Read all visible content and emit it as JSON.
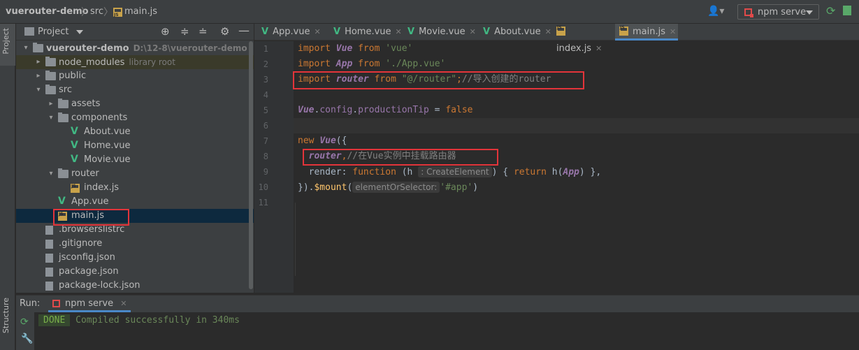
{
  "breadcrumb": {
    "project": "vuerouter-demo",
    "folder": "src",
    "file": "main.js"
  },
  "toolbar": {
    "run_config": "npm serve"
  },
  "left_stripe": {
    "project_tab": "Project",
    "structure_tab": "Structure"
  },
  "project_panel": {
    "title": "Project",
    "tree": [
      {
        "label": "vuerouter-demo",
        "hint": "D:\\12-8\\vuerouter-demo",
        "type": "folder",
        "level": 0,
        "expanded": true
      },
      {
        "label": "node_modules",
        "hint": "library root",
        "type": "folder",
        "level": 1,
        "expanded": false
      },
      {
        "label": "public",
        "hint": "",
        "type": "folder",
        "level": 1,
        "expanded": false
      },
      {
        "label": "src",
        "hint": "",
        "type": "folder",
        "level": 1,
        "expanded": true
      },
      {
        "label": "assets",
        "hint": "",
        "type": "folder",
        "level": 2,
        "expanded": false
      },
      {
        "label": "components",
        "hint": "",
        "type": "folder",
        "level": 2,
        "expanded": true
      },
      {
        "label": "About.vue",
        "hint": "",
        "type": "vue",
        "level": 3
      },
      {
        "label": "Home.vue",
        "hint": "",
        "type": "vue",
        "level": 3
      },
      {
        "label": "Movie.vue",
        "hint": "",
        "type": "vue",
        "level": 3
      },
      {
        "label": "router",
        "hint": "",
        "type": "folder",
        "level": 2,
        "expanded": true
      },
      {
        "label": "index.js",
        "hint": "",
        "type": "js",
        "level": 3
      },
      {
        "label": "App.vue",
        "hint": "",
        "type": "vue",
        "level": 2
      },
      {
        "label": "main.js",
        "hint": "",
        "type": "js",
        "level": 2,
        "selected": true
      },
      {
        "label": ".browserslistrc",
        "hint": "",
        "type": "file",
        "level": 1
      },
      {
        "label": ".gitignore",
        "hint": "",
        "type": "file",
        "level": 1
      },
      {
        "label": "jsconfig.json",
        "hint": "",
        "type": "file",
        "level": 1
      },
      {
        "label": "package.json",
        "hint": "",
        "type": "file",
        "level": 1
      },
      {
        "label": "package-lock.json",
        "hint": "",
        "type": "file",
        "level": 1
      }
    ]
  },
  "editor": {
    "tabs": [
      {
        "label": "App.vue",
        "type": "vue"
      },
      {
        "label": "Home.vue",
        "type": "vue"
      },
      {
        "label": "Movie.vue",
        "type": "vue"
      },
      {
        "label": "About.vue",
        "type": "vue"
      },
      {
        "label": "index.js",
        "type": "js"
      },
      {
        "label": "main.js",
        "type": "js",
        "active": true
      }
    ],
    "line_numbers": [
      "1",
      "2",
      "3",
      "4",
      "5",
      "6",
      "7",
      "8",
      "9",
      "10",
      "11"
    ],
    "code": {
      "l1": {
        "kw": "import",
        "name": "Vue",
        "from": "from",
        "str": "'vue'"
      },
      "l2": {
        "kw": "import",
        "name": "App",
        "from": "from",
        "str": "'./App.vue'"
      },
      "l3": {
        "kw": "import",
        "name": "router",
        "from": "from",
        "str": "\"@/router\"",
        "semi": ";",
        "comment": "//导入创建的router"
      },
      "l5": {
        "obj": "Vue",
        "dot1": ".",
        "config": "config",
        "dot2": ".",
        "prop": "productionTip",
        "eq": " = ",
        "val": "false"
      },
      "l7": {
        "kw": "new",
        "cls": "Vue",
        "open": "({"
      },
      "l8": {
        "prop": "router",
        "comma": ",",
        "comment": "//在Vue实例中挂载路由器"
      },
      "l9": {
        "key": "render",
        "colon": ": ",
        "kw": "function",
        "paren": " (h",
        "hint": ": CreateElement",
        "rest1": ") { ",
        "ret": "return",
        "call": " h(",
        "arg": "App",
        "rest2": ") },"
      },
      "l10": {
        "close": "}).",
        "fn": "$mount",
        "paren": "(",
        "hint": "elementOrSelector:",
        "str": "'#app'",
        "end": ")"
      }
    }
  },
  "run_panel": {
    "label": "Run:",
    "tab": "npm serve",
    "badge": "DONE",
    "message": "Compiled successfully in 340ms"
  }
}
